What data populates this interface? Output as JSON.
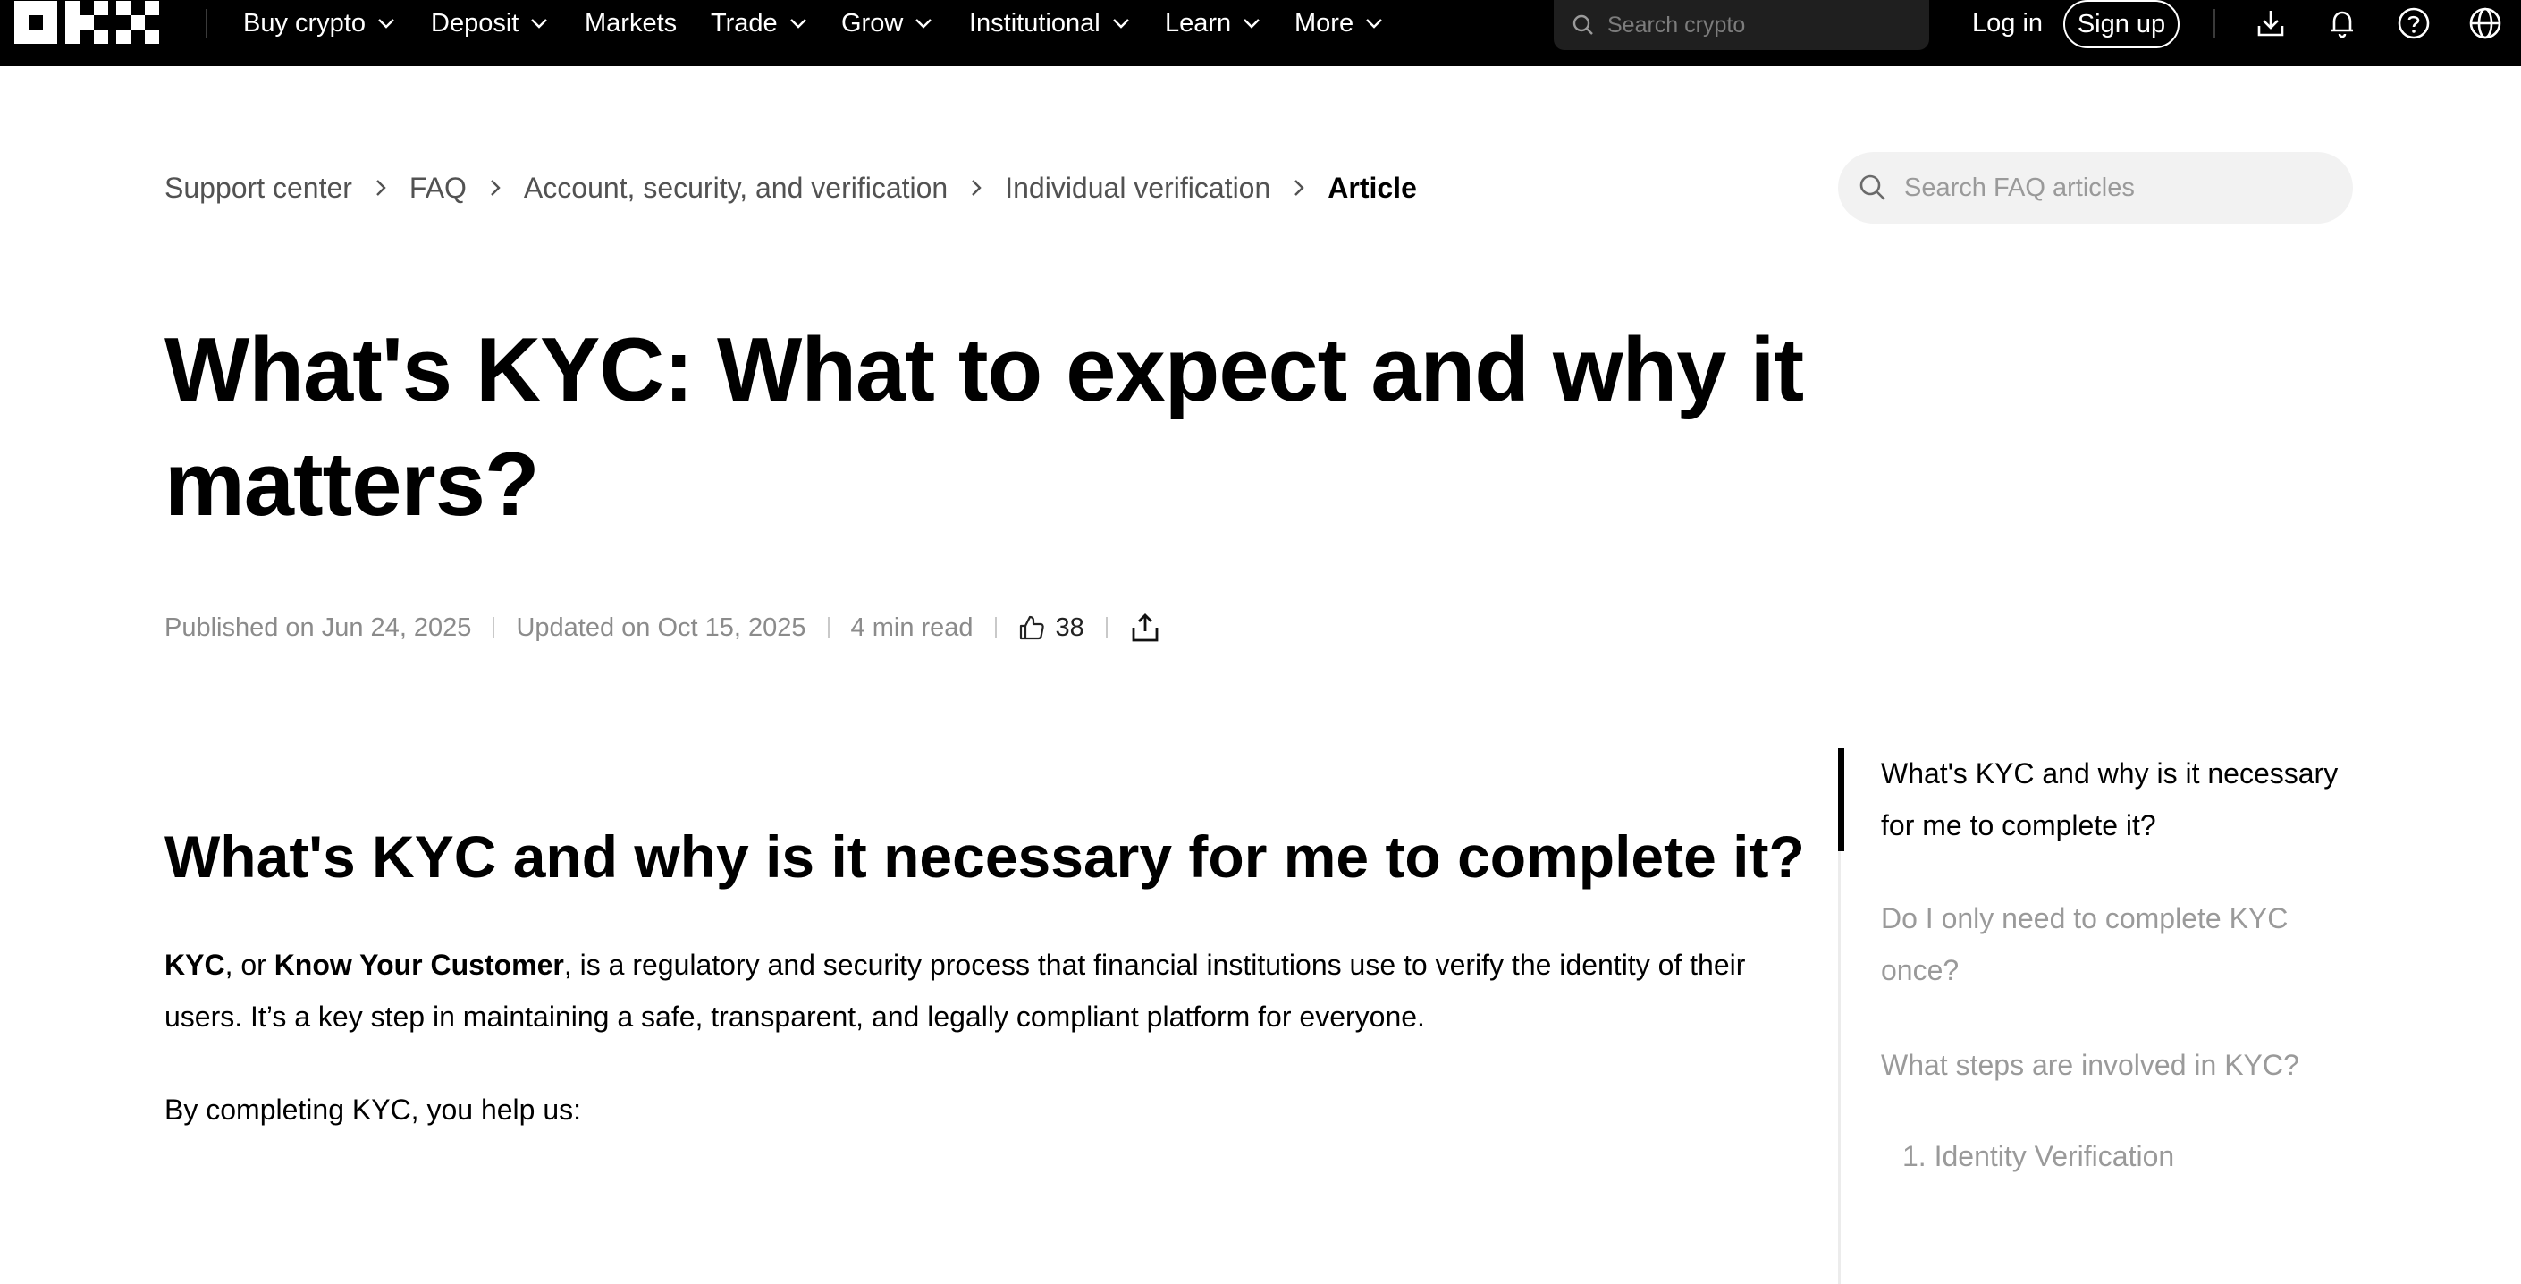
{
  "nav": {
    "items": [
      {
        "label": "Buy crypto",
        "has_dropdown": true
      },
      {
        "label": "Deposit",
        "has_dropdown": true
      },
      {
        "label": "Markets",
        "has_dropdown": false
      },
      {
        "label": "Trade",
        "has_dropdown": true
      },
      {
        "label": "Grow",
        "has_dropdown": true
      },
      {
        "label": "Institutional",
        "has_dropdown": true
      },
      {
        "label": "Learn",
        "has_dropdown": true
      },
      {
        "label": "More",
        "has_dropdown": true
      }
    ],
    "search_placeholder": "Search crypto",
    "login_label": "Log in",
    "signup_label": "Sign up",
    "icons": [
      "download-icon",
      "bell-icon",
      "help-icon",
      "globe-icon"
    ]
  },
  "breadcrumb": [
    "Support center",
    "FAQ",
    "Account, security, and verification",
    "Individual verification",
    "Article"
  ],
  "faq_search_placeholder": "Search FAQ articles",
  "article": {
    "title": "What's KYC: What to expect and why it matters?",
    "published": "Published on Jun 24, 2025",
    "updated": "Updated on Oct 15, 2025",
    "read_time": "4 min read",
    "likes": "38",
    "section_heading": "What's KYC and why is it necessary for me to complete it?",
    "para1": {
      "kyc": "KYC",
      "or": ", or ",
      "kyc_full": "Know Your Customer",
      "rest": ", is a regulatory and security process that financial institutions use to verify the identity of their users. It’s a key step in maintaining a safe, transparent, and legally compliant platform for everyone."
    },
    "para2": "By completing KYC, you help us:"
  },
  "toc": [
    {
      "label": "What's KYC and why is it necessary for me to complete it?",
      "active": true
    },
    {
      "label": "Do I only need to complete KYC once?",
      "active": false
    },
    {
      "label": "What steps are involved in KYC?",
      "active": false
    },
    {
      "label": "1. Identity Verification",
      "active": false
    }
  ],
  "colors": {
    "nav_bg": "#000000",
    "text_primary": "#000000",
    "text_muted": "#8b8b8b",
    "toc_inactive": "#9a9a9a",
    "search_bg": "#f2f2f2"
  }
}
